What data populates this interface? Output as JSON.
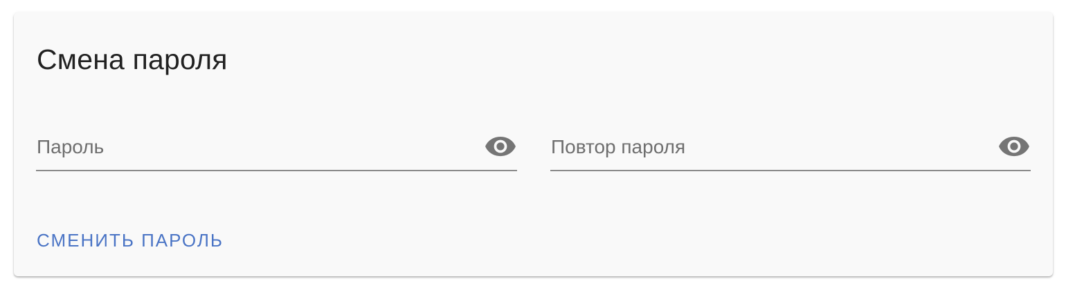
{
  "form": {
    "title": "Смена пароля",
    "password_field": {
      "value": "",
      "placeholder": "Пароль",
      "toggle_icon": "eye-icon"
    },
    "repeat_password_field": {
      "value": "",
      "placeholder": "Повтор пароля",
      "toggle_icon": "eye-icon"
    },
    "submit_label": "СМЕНИТЬ ПАРОЛЬ"
  },
  "colors": {
    "card_background": "#f9f9f9",
    "title_text": "#212121",
    "placeholder_text": "#6e6e6e",
    "underline": "#8a8a8a",
    "icon": "#757575",
    "accent": "#4a74c5"
  }
}
